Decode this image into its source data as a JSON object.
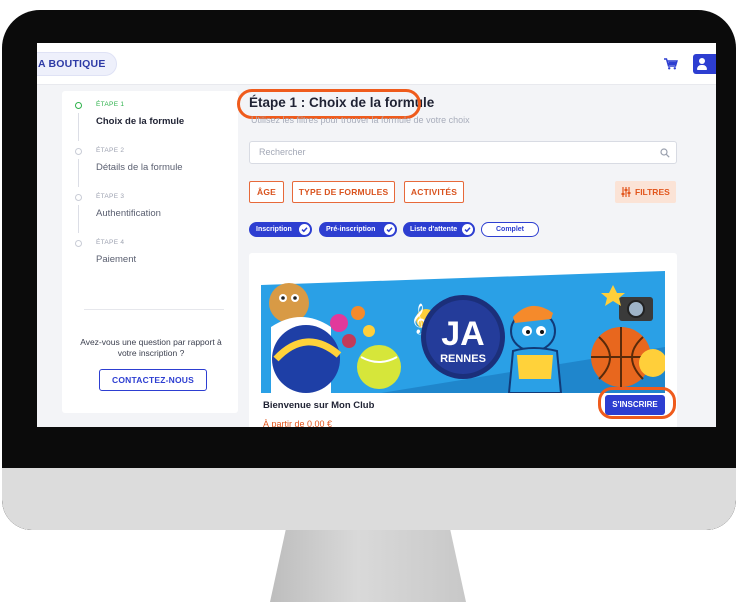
{
  "topbar": {
    "shop_label": "A BOUTIQUE",
    "cart_icon": "cart-icon",
    "user_icon": "user-icon"
  },
  "steps": [
    {
      "kicker": "ÉTAPE 1",
      "name": "Choix de la formule",
      "active": true
    },
    {
      "kicker": "ÉTAPE 2",
      "name": "Détails de la formule",
      "active": false
    },
    {
      "kicker": "ÉTAPE 3",
      "name": "Authentification",
      "active": false
    },
    {
      "kicker": "ÉTAPE 4",
      "name": "Paiement",
      "active": false
    }
  ],
  "help": {
    "question": "Avez-vous une question par rapport à votre inscription ?",
    "contact_label": "CONTACTEZ-NOUS"
  },
  "main": {
    "title": "Étape 1 : Choix de la formule",
    "subtitle": "Utilisez les filtres pour trouver la formule de votre choix",
    "search_placeholder": "Rechercher",
    "chips": [
      "ÂGE",
      "TYPE DE FORMULES",
      "ACTIVITÉS"
    ],
    "filters_label": "FILTRES",
    "status_pills": [
      {
        "label": "Inscription",
        "checked": true
      },
      {
        "label": "Pré-inscription",
        "checked": true
      },
      {
        "label": "Liste d'attente",
        "checked": true
      },
      {
        "label": "Complet",
        "checked": false
      }
    ]
  },
  "card": {
    "logo_text": "JA",
    "logo_sub": "RENNES",
    "title": "Bienvenue sur Mon Club",
    "price": "À partir de 0,00 €",
    "signup_label": "S'INSCRIRE"
  },
  "colors": {
    "accent_blue": "#2d3ed1",
    "accent_orange": "#e2561d",
    "step_green": "#2fb24c",
    "highlight": "#ef5b1c"
  }
}
